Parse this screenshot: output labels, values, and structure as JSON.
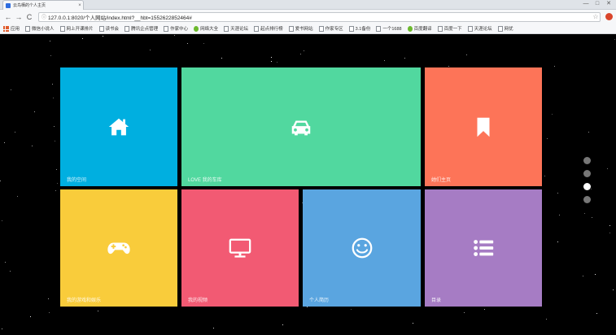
{
  "browser": {
    "tab_title": "云鸟栖的个人主页",
    "tab_close": "×",
    "window_buttons": {
      "minimize": "—",
      "maximize": "□",
      "close": "✕"
    },
    "nav": {
      "back": "←",
      "forward": "→",
      "reload": "C"
    },
    "url_info": "ⓘ",
    "url": "127.0.0.1:8020/个人网站/index.html?__hbt=1552622852464#",
    "bookmarks": [
      {
        "label": "应用",
        "icon": "apps-icon"
      },
      {
        "label": "微信小说人",
        "icon": "page-icon"
      },
      {
        "label": "网上开课排片",
        "icon": "page-icon"
      },
      {
        "label": "读书会",
        "icon": "page-icon"
      },
      {
        "label": "腾讯企点管理",
        "icon": "page-icon"
      },
      {
        "label": "作家中心",
        "icon": "page-icon"
      },
      {
        "label": "网络大全",
        "icon": "circle-icon"
      },
      {
        "label": "天涯论坛",
        "icon": "page-icon"
      },
      {
        "label": "起点排行榜",
        "icon": "page-icon"
      },
      {
        "label": "爱书网站",
        "icon": "page-icon"
      },
      {
        "label": "作家专区",
        "icon": "page-icon"
      },
      {
        "label": "3.1备份",
        "icon": "page-icon"
      },
      {
        "label": "一个1688",
        "icon": "page-icon"
      },
      {
        "label": "百度翻译",
        "icon": "circle-icon"
      },
      {
        "label": "百度一下",
        "icon": "page-icon"
      },
      {
        "label": "天涯论坛",
        "icon": "page-icon"
      },
      {
        "label": "网优",
        "icon": "page-icon"
      }
    ]
  },
  "tiles": {
    "home": {
      "label": "我的空间",
      "color": "#00afe0",
      "icon": "home-icon"
    },
    "car": {
      "label": "LOVE 我的车库",
      "color": "#51d89f",
      "icon": "car-icon"
    },
    "bookmark": {
      "label": "她们主页",
      "color": "#fd7458",
      "icon": "bookmark-icon"
    },
    "game": {
      "label": "我的游戏和娱乐",
      "color": "#f9cc3b",
      "icon": "gamepad-icon"
    },
    "tv": {
      "label": "我的视频",
      "color": "#f25a73",
      "icon": "monitor-icon"
    },
    "smile": {
      "label": "个人简历",
      "color": "#5aa5e0",
      "icon": "smile-icon"
    },
    "list": {
      "label": "目录",
      "color": "#a67cc4",
      "icon": "list-icon"
    }
  },
  "pagination": {
    "count": 4,
    "active_index": 2
  }
}
